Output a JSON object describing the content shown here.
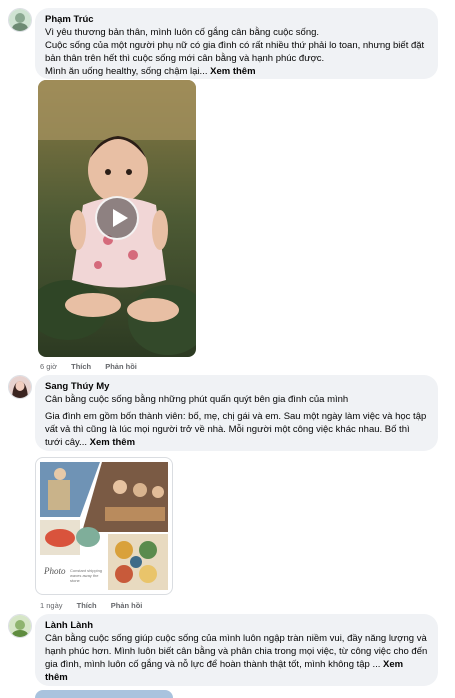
{
  "comments": [
    {
      "name": "Phạm Trúc",
      "lines": [
        "Vì yêu thương bản thân, mình luôn cố gắng cân bằng cuộc sống.",
        "Cuộc sống của một người phụ nữ có gia đình có rất nhiều thứ phải lo toan, nhưng biết đặt bản thân trên hết thì cuộc sống mới cân bằng và hạnh phúc được.",
        "Mình ăn uống healthy, sống chậm lại..."
      ],
      "see_more": "Xem thêm",
      "time": "6 giờ",
      "like": "Thích",
      "reply": "Phản hồi"
    },
    {
      "name": "Sang Thúy My",
      "lines": [
        "Cân bằng cuộc sống bằng những phút quấn quýt bên gia đình của mình",
        "Gia đình em gồm bốn thành viên: bố, mẹ, chị gái và em. Sau một ngày làm việc và học tập vất vả thì cũng là lúc mọi người trở về nhà. Mỗi người một công việc khác nhau. Bố thì tưới cây..."
      ],
      "see_more": "Xem thêm",
      "time": "1 ngày",
      "like": "Thích",
      "reply": "Phản hồi",
      "collage_caption": "Constant shipping waves away the stone",
      "collage_brand": "Photo"
    },
    {
      "name": "Lành Lành",
      "lines": [
        "Cân bằng cuộc sống giúp cuộc sống của mình luôn ngập tràn niềm vui, đầy năng lượng và hạnh phúc hơn. Mình luôn biết cân bằng và phân chia trong mọi việc, từ công việc cho đến gia đình, mình luôn cố gắng và nỗ lực để hoàn thành thật tốt, mình không tập ..."
      ],
      "see_more": "Xem thêm"
    }
  ],
  "colors": {
    "bubble_bg": "#f0f2f5",
    "meta_text": "#65676b",
    "play_overlay": "#3c3c3c"
  },
  "icons": [
    "play-icon"
  ]
}
